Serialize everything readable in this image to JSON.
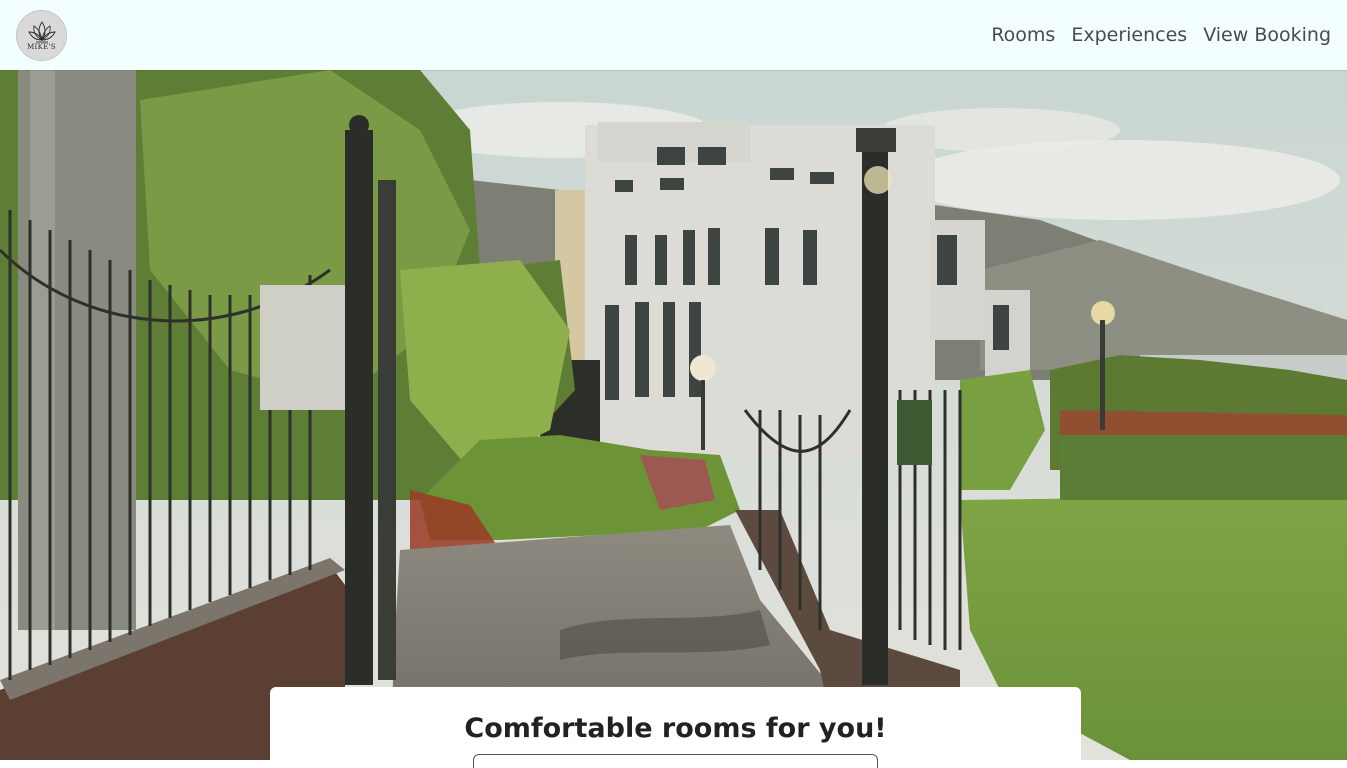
{
  "brand": {
    "logo_text": "MIKE'S",
    "logo_icon": "lotus-icon"
  },
  "nav": {
    "items": [
      {
        "label": "Rooms"
      },
      {
        "label": "Experiences"
      },
      {
        "label": "View Booking"
      }
    ]
  },
  "hero": {
    "image": "garden-gate-hotel-photo"
  },
  "card": {
    "title": "Comfortable rooms for you!"
  },
  "colors": {
    "navbar_bg": "#f2feff",
    "nav_text": "#4b4b4b",
    "card_bg": "#ffffff"
  }
}
